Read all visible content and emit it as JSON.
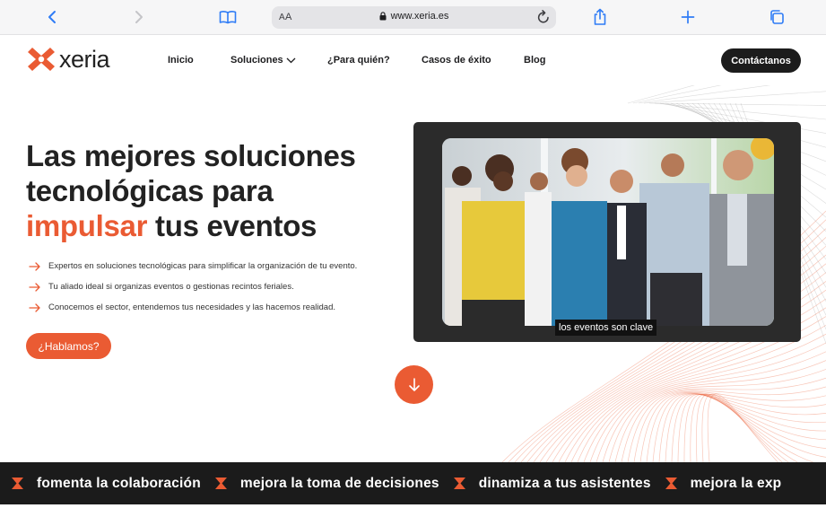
{
  "browser": {
    "text_size_label_small": "A",
    "text_size_label_big": "A",
    "url": "www.xeria.es",
    "icons": [
      "back-icon",
      "forward-icon",
      "bookmarks-icon",
      "lock-icon",
      "reload-icon",
      "share-icon",
      "new-tab-icon",
      "tabs-icon"
    ]
  },
  "site": {
    "brand": "xeria",
    "nav": {
      "inicio": "Inicio",
      "soluciones": "Soluciones",
      "para_quien": "¿Para quién?",
      "casos": "Casos de éxito",
      "blog": "Blog"
    },
    "contact_label": "Contáctanos"
  },
  "hero": {
    "headline_line1": "Las mejores soluciones",
    "headline_line2": "tecnológicas para",
    "headline_accent": "impulsar",
    "headline_line3_rest": " tus eventos",
    "bullets": [
      "Expertos en soluciones tecnológicas para simplificar la organización de tu evento.",
      "Tu aliado ideal si organizas eventos o gestionas recintos feriales.",
      "Conocemos el sector, entendemos tus necesidades y las hacemos realidad."
    ],
    "cta_label": "¿Hablamos?",
    "video_caption": "los eventos son clave"
  },
  "marquee": {
    "items": [
      "fomenta la colaboración",
      "mejora la toma de decisiones",
      "dinamiza a tus asistentes",
      "mejora la exp"
    ]
  },
  "colors": {
    "accent": "#ea5b33",
    "dark": "#1b1b1b",
    "video_frame": "#2b2b2b"
  }
}
